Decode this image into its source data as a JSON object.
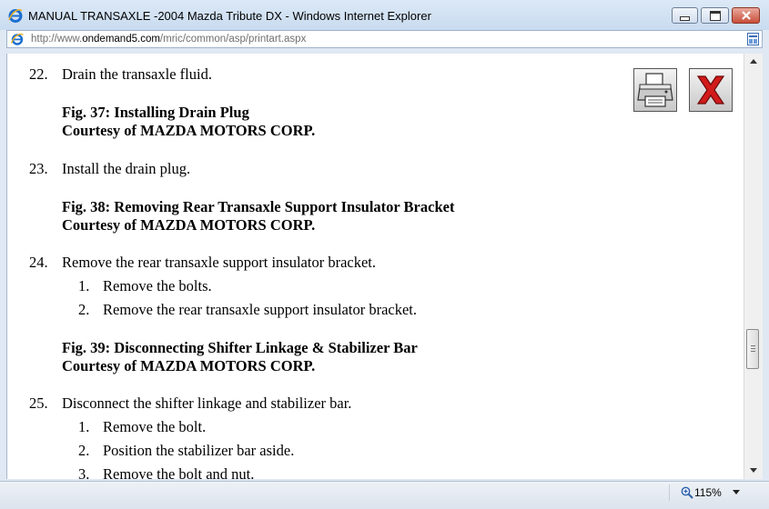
{
  "window": {
    "title": "MANUAL TRANSAXLE -2004 Mazda Tribute DX - Windows Internet Explorer",
    "icon": "ie-logo-icon",
    "controls": [
      "minimize-icon",
      "maximize-icon",
      "close-icon"
    ]
  },
  "address": {
    "url_prefix": "http://www.",
    "url_domain": "ondemand5.com",
    "url_path": "/mric/common/asp/printart.aspx",
    "page_icon": "page-icon",
    "compat_icon": "compatibility-view-icon"
  },
  "toolbar": {
    "print_icon": "printer-icon",
    "close_icon": "red-x-icon"
  },
  "document": {
    "step22": {
      "num": "22.",
      "text": "Drain the transaxle fluid."
    },
    "fig37": {
      "title": "Fig. 37: Installing Drain Plug",
      "credit": "Courtesy of MAZDA MOTORS CORP."
    },
    "step23": {
      "num": "23.",
      "text": "Install the drain plug."
    },
    "fig38": {
      "title": "Fig. 38: Removing Rear Transaxle Support Insulator Bracket",
      "credit": "Courtesy of MAZDA MOTORS CORP."
    },
    "step24": {
      "num": "24.",
      "text": "Remove the rear transaxle support insulator bracket.",
      "subs": [
        {
          "num": "1.",
          "text": "Remove the bolts."
        },
        {
          "num": "2.",
          "text": "Remove the rear transaxle support insulator bracket."
        }
      ]
    },
    "fig39": {
      "title": "Fig. 39: Disconnecting Shifter Linkage & Stabilizer Bar",
      "credit": "Courtesy of MAZDA MOTORS CORP."
    },
    "step25": {
      "num": "25.",
      "text": "Disconnect the shifter linkage and stabilizer bar.",
      "subs": [
        {
          "num": "1.",
          "text": "Remove the bolt."
        },
        {
          "num": "2.",
          "text": "Position the stabilizer bar aside."
        },
        {
          "num": "3.",
          "text": "Remove the bolt and nut."
        }
      ]
    }
  },
  "status": {
    "zoom": "115%",
    "zoom_icon": "zoom-magnifier-icon"
  },
  "colors": {
    "close_x_red": "#d21b1b",
    "ie_blue": "#1c6fd1",
    "title_bar": "#c9dbef"
  }
}
